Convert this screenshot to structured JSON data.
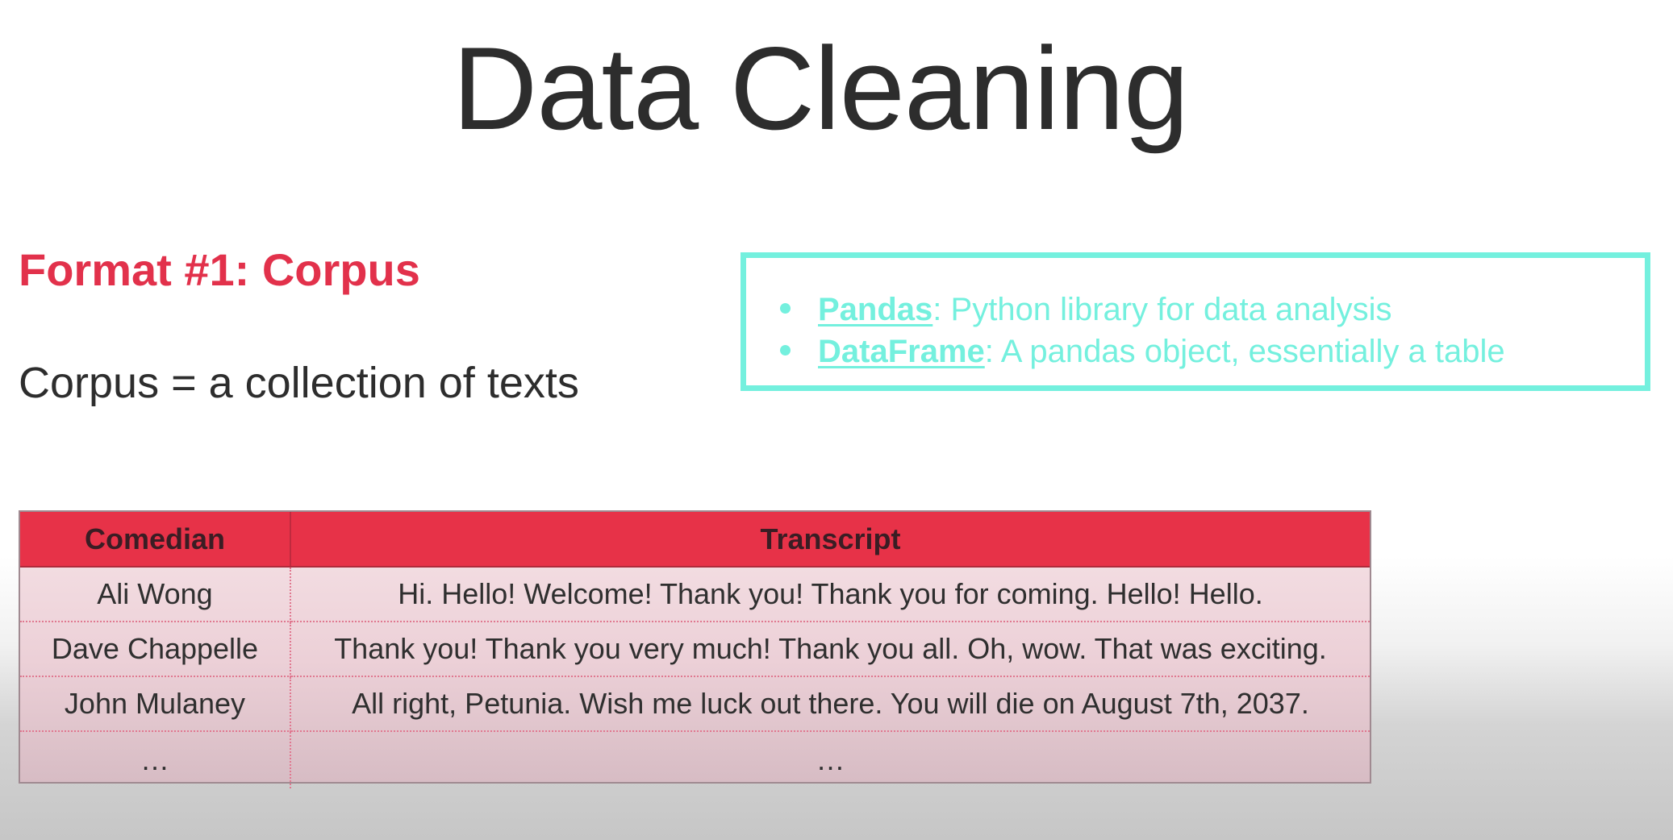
{
  "slide": {
    "title": "Data Cleaning",
    "format_heading": "Format #1: Corpus",
    "definition": "Corpus = a collection of texts"
  },
  "info_box": {
    "items": [
      {
        "term": "Pandas",
        "description": ": Python library for data analysis"
      },
      {
        "term": "DataFrame",
        "description": ": A pandas object, essentially a table"
      }
    ]
  },
  "table": {
    "headers": [
      "Comedian",
      "Transcript"
    ],
    "rows": [
      [
        "Ali Wong",
        "Hi. Hello! Welcome! Thank you! Thank you for coming. Hello! Hello."
      ],
      [
        "Dave Chappelle",
        "Thank you! Thank you very much! Thank you all. Oh, wow. That was exciting."
      ],
      [
        "John Mulaney",
        "All right, Petunia. Wish me luck out there. You will die on August 7th, 2037."
      ],
      [
        "…",
        "…"
      ]
    ]
  },
  "colors": {
    "accent_red": "#e2314b",
    "header_red": "#e73248",
    "box_teal": "#74f0de",
    "text_dark": "#2d2d2d"
  }
}
